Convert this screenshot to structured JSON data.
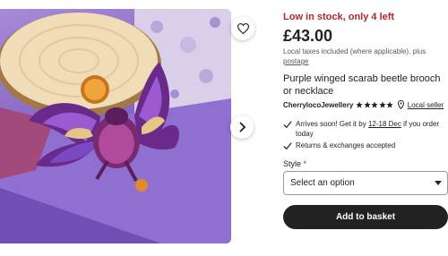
{
  "photo": {
    "alt_icon": "brooch-photo",
    "favorite_icon": "heart-icon",
    "next_icon": "chevron-right-icon"
  },
  "listing": {
    "stock_status": "Low in stock, only 4 left",
    "price": "£43.00",
    "tax_note": "Local taxes included (where applicable), plus",
    "tax_link": "postage",
    "title": "Purple winged scarab beetle brooch or necklace"
  },
  "seller": {
    "shop_name": "CherrylocoJewellery",
    "rating": 5,
    "rating_max": 5,
    "star_icon": "star-icon",
    "location_icon": "location-pin-icon",
    "local_seller_label": "Local seller"
  },
  "delivery": {
    "arrival_prefix": "Arrives soon! Get it by",
    "arrival_dates": "12-18 Dec",
    "arrival_suffix": "if you order today",
    "returns": "Returns & exchanges accepted",
    "check_icon": "check-icon"
  },
  "options": {
    "style_label": "Style",
    "required_mark": "*",
    "select_placeholder": "Select an option",
    "caret_icon": "caret-down-icon"
  },
  "actions": {
    "add_to_basket": "Add to basket"
  },
  "colors": {
    "accent_red": "#b1292c",
    "button_dark": "#222222"
  }
}
